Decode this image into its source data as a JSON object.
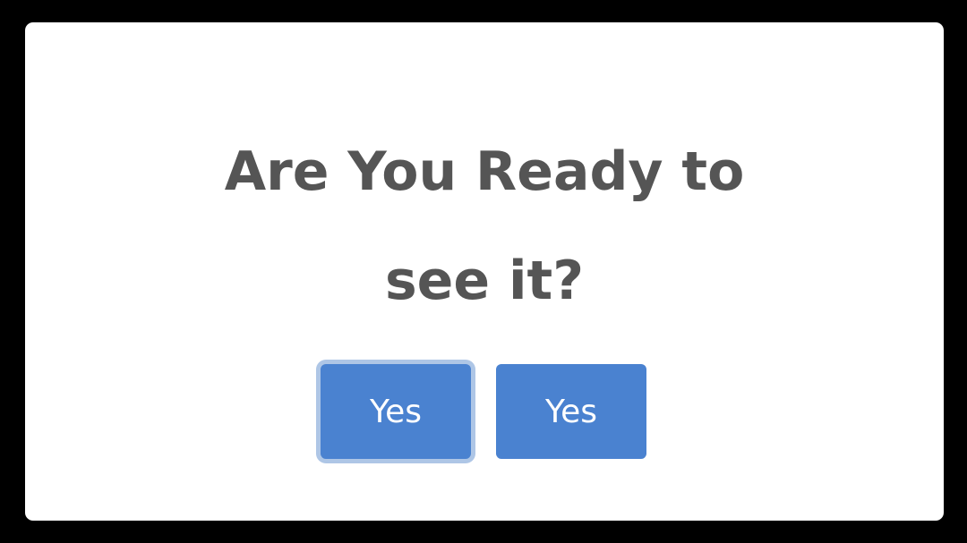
{
  "dialog": {
    "title_line_1": "Are You Ready to",
    "title_line_2": "see it?",
    "buttons": [
      {
        "label": "Yes",
        "focused": true
      },
      {
        "label": "Yes",
        "focused": false
      }
    ]
  },
  "colors": {
    "background": "#000000",
    "dialog": "#ffffff",
    "title_text": "#555555",
    "button": "#4a82d0",
    "button_text": "#ffffff",
    "focus_ring": "#aec6e6"
  }
}
